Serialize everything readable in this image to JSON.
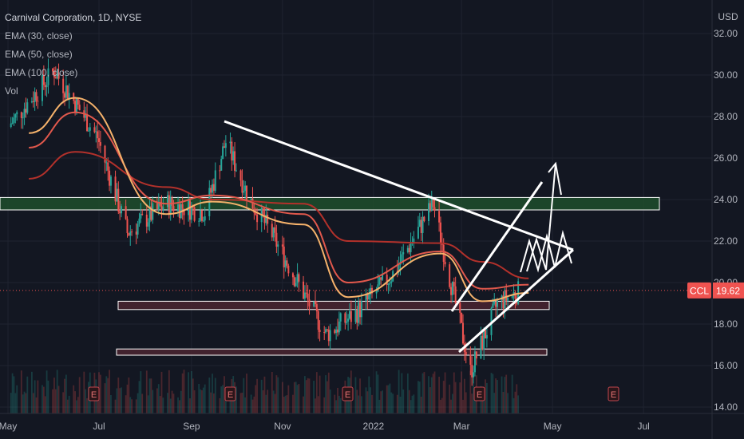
{
  "legend": {
    "title": "Carnival Corporation, 1D, NYSE",
    "indicators": [
      "EMA (30, close)",
      "EMA (50, close)",
      "EMA (100, close)",
      "Vol"
    ]
  },
  "price_axis": {
    "currency": "USD",
    "ticks": [
      "32.00",
      "30.00",
      "28.00",
      "26.00",
      "24.00",
      "22.00",
      "20.00",
      "18.00",
      "16.00",
      "14.00"
    ]
  },
  "time_axis": {
    "ticks": [
      "May",
      "Jul",
      "Sep",
      "Nov",
      "2022",
      "Mar",
      "May",
      "Jul"
    ]
  },
  "last_price": {
    "symbol": "CCL",
    "value": "19.62"
  },
  "earnings_marker": {
    "label": "E",
    "count": 5
  },
  "colors": {
    "background": "#131722",
    "up": "#26a69a",
    "down": "#ef5350",
    "ema30": "#f5b26b",
    "ema50": "#e0584c",
    "ema100": "#b3312b",
    "drawing": "#ffffff",
    "resistance_zone": "#1e4d2b",
    "support_zone": "#4a2430"
  },
  "chart_data": {
    "type": "candlestick",
    "symbol": "CCL",
    "title": "Carnival Corporation, 1D, NYSE",
    "ylim": [
      14,
      32
    ],
    "ylabel": "USD",
    "price_key_points": [
      {
        "date": "2021-05-01",
        "close": 27.5
      },
      {
        "date": "2021-06-01",
        "close": 30.2
      },
      {
        "date": "2021-06-30",
        "close": 27.0
      },
      {
        "date": "2021-07-20",
        "close": 22.4
      },
      {
        "date": "2021-08-15",
        "close": 23.8
      },
      {
        "date": "2021-09-10",
        "close": 23.4
      },
      {
        "date": "2021-09-24",
        "close": 26.8
      },
      {
        "date": "2021-10-10",
        "close": 24.0
      },
      {
        "date": "2021-10-25",
        "close": 22.3
      },
      {
        "date": "2021-11-30",
        "close": 17.5
      },
      {
        "date": "2021-12-20",
        "close": 18.5
      },
      {
        "date": "2022-01-15",
        "close": 20.5
      },
      {
        "date": "2022-02-10",
        "close": 23.8
      },
      {
        "date": "2022-02-28",
        "close": 18.0
      },
      {
        "date": "2022-03-07",
        "close": 15.7
      },
      {
        "date": "2022-03-25",
        "close": 19.0
      },
      {
        "date": "2022-04-10",
        "close": 19.62
      }
    ],
    "ema30_key_points": [
      [
        27.2,
        "2021-05"
      ],
      [
        28.9,
        "2021-06"
      ],
      [
        23.3,
        "2021-08"
      ],
      [
        23.9,
        "2021-09"
      ],
      [
        22.8,
        "2021-11"
      ],
      [
        19.3,
        "2021-12"
      ],
      [
        21.4,
        "2022-02"
      ],
      [
        19.1,
        "2022-03"
      ],
      [
        19.5,
        "2022-04"
      ]
    ],
    "ema50_key_points": [
      [
        26.5,
        "2021-05"
      ],
      [
        28.2,
        "2021-06"
      ],
      [
        23.8,
        "2021-08"
      ],
      [
        24.2,
        "2021-09"
      ],
      [
        23.3,
        "2021-11"
      ],
      [
        20.0,
        "2021-12"
      ],
      [
        21.5,
        "2022-02"
      ],
      [
        19.7,
        "2022-03"
      ],
      [
        19.9,
        "2022-04"
      ]
    ],
    "ema100_key_points": [
      [
        25.0,
        "2021-05"
      ],
      [
        26.3,
        "2021-06"
      ],
      [
        24.6,
        "2021-08"
      ],
      [
        24.0,
        "2021-09"
      ],
      [
        23.8,
        "2021-11"
      ],
      [
        22.0,
        "2021-12"
      ],
      [
        21.9,
        "2022-02"
      ],
      [
        21.0,
        "2022-03"
      ],
      [
        20.2,
        "2022-04"
      ]
    ],
    "resistance_zone": [
      23.5,
      24.1
    ],
    "support_zones": [
      [
        18.7,
        19.1
      ],
      [
        16.5,
        16.8
      ]
    ],
    "last_price": 19.62,
    "grid": true,
    "legend_position": "top-left"
  }
}
